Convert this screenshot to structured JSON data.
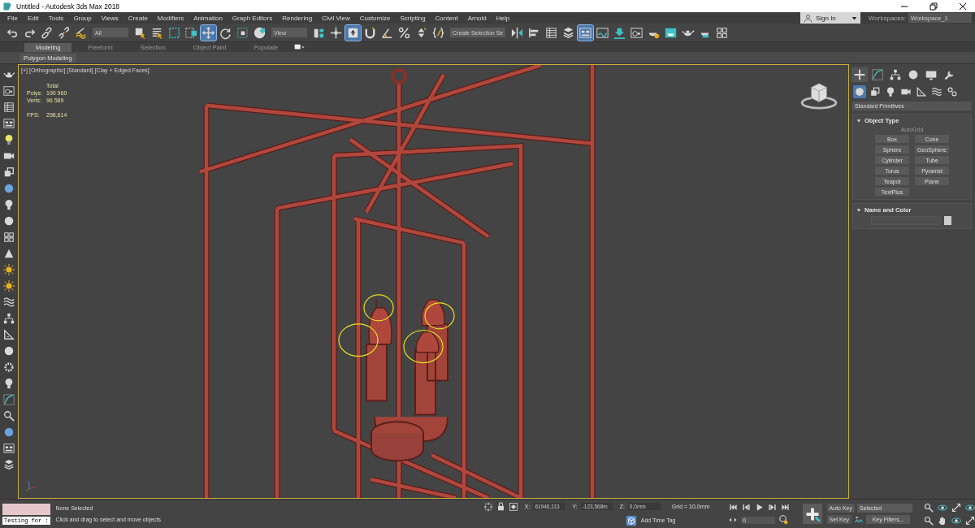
{
  "window": {
    "title": "Untitled - Autodesk 3ds Max 2018"
  },
  "menu": [
    "File",
    "Edit",
    "Tools",
    "Group",
    "Views",
    "Create",
    "Modifiers",
    "Animation",
    "Graph Editors",
    "Rendering",
    "Civil View",
    "Customize",
    "Scripting",
    "Content",
    "Arnold",
    "Help"
  ],
  "account": {
    "label": "Sign In"
  },
  "workspaces": {
    "label": "Workspaces:",
    "value": "Workspace_1"
  },
  "toolbar": [
    {
      "kind": "tool",
      "selected": false
    },
    {
      "kind": "tool",
      "selected": false
    },
    {
      "kind": "tool",
      "selected": false
    },
    {
      "kind": "tool",
      "selected": false
    },
    {
      "kind": "tool",
      "selected": false
    },
    {
      "kind": "dropdown",
      "value": "All"
    },
    {
      "kind": "tool",
      "selected": false
    },
    {
      "kind": "tool",
      "selected": false
    },
    {
      "kind": "tool",
      "selected": false
    },
    {
      "kind": "tool",
      "selected": false
    },
    {
      "kind": "tool",
      "selected": true
    },
    {
      "kind": "tool",
      "selected": false
    },
    {
      "kind": "tool",
      "selected": false
    },
    {
      "kind": "tool",
      "selected": false
    },
    {
      "kind": "dropdown",
      "value": "View"
    },
    {
      "kind": "tool",
      "selected": false
    },
    {
      "kind": "tool",
      "selected": false
    },
    {
      "kind": "tool",
      "selected": true
    },
    {
      "kind": "tool",
      "selected": false
    },
    {
      "kind": "tool",
      "selected": false
    },
    {
      "kind": "tool",
      "selected": false
    },
    {
      "kind": "tool",
      "selected": false
    },
    {
      "kind": "tool",
      "selected": false
    },
    {
      "kind": "dropdown",
      "value": "Create Selection Se"
    },
    {
      "kind": "tool",
      "selected": false
    },
    {
      "kind": "tool",
      "selected": false
    },
    {
      "kind": "tool",
      "selected": false
    },
    {
      "kind": "tool",
      "selected": false
    },
    {
      "kind": "tool",
      "selected": true
    },
    {
      "kind": "tool",
      "selected": false
    },
    {
      "kind": "tool",
      "selected": false
    },
    {
      "kind": "tool",
      "selected": false
    },
    {
      "kind": "tool",
      "selected": false
    },
    {
      "kind": "tool",
      "selected": false
    },
    {
      "kind": "tool",
      "selected": false
    },
    {
      "kind": "tool",
      "selected": false
    },
    {
      "kind": "tool",
      "selected": false
    }
  ],
  "ribbon": {
    "tabs": [
      {
        "label": "Modeling",
        "selected": true
      },
      {
        "label": "Freeform",
        "selected": false
      },
      {
        "label": "Selection",
        "selected": false
      },
      {
        "label": "Object Paint",
        "selected": false
      },
      {
        "label": "Populate",
        "selected": false
      }
    ],
    "panel": "Polygon Modeling"
  },
  "viewport": {
    "labels": [
      "[+]",
      "[Orthographic]",
      "[Standard]",
      "[Clay + Edged Faces]"
    ],
    "stats": {
      "header": "Total",
      "rows": [
        {
          "label": "Polys:",
          "value": "190 960"
        },
        {
          "label": "Verts:",
          "value": "96 589"
        },
        {
          "label": "FPS:",
          "value": "298,614"
        }
      ]
    }
  },
  "command_panel": {
    "tabs": [
      {
        "selected": true
      },
      {
        "selected": false
      },
      {
        "selected": false
      },
      {
        "selected": false
      },
      {
        "selected": false
      },
      {
        "selected": false
      }
    ],
    "categories": [
      {
        "selected": true
      },
      {
        "selected": false
      },
      {
        "selected": false
      },
      {
        "selected": false
      },
      {
        "selected": false
      },
      {
        "selected": false
      },
      {
        "selected": false
      }
    ],
    "dropdown": "Standard Primitives",
    "object_type": {
      "title": "Object Type",
      "autogrid": {
        "label": "AutoGrid",
        "disabled": true
      },
      "buttons": [
        "Box",
        "Cone",
        "Sphere",
        "GeoSphere",
        "Cylinder",
        "Tube",
        "Torus",
        "Pyramid",
        "Teapot",
        "Plane",
        "TextPlus"
      ]
    },
    "name_and_color": {
      "title": "Name and Color"
    }
  },
  "status": {
    "script_field": "Testing for :",
    "selection": "None Selected",
    "prompt": "Click and drag to select and move objects",
    "coords": [
      {
        "label": "X:",
        "value": "61946,113"
      },
      {
        "label": "Y:",
        "value": "-123,568m"
      },
      {
        "label": "Z:",
        "value": "0,0mm"
      }
    ],
    "grid": "Grid = 10,0mm",
    "time_tag": "Add Time Tag",
    "frame": "0",
    "auto_key": "Auto Key",
    "key_mode": "Selected",
    "set_key": "Set Key",
    "key_filters": "Key Filters..."
  }
}
